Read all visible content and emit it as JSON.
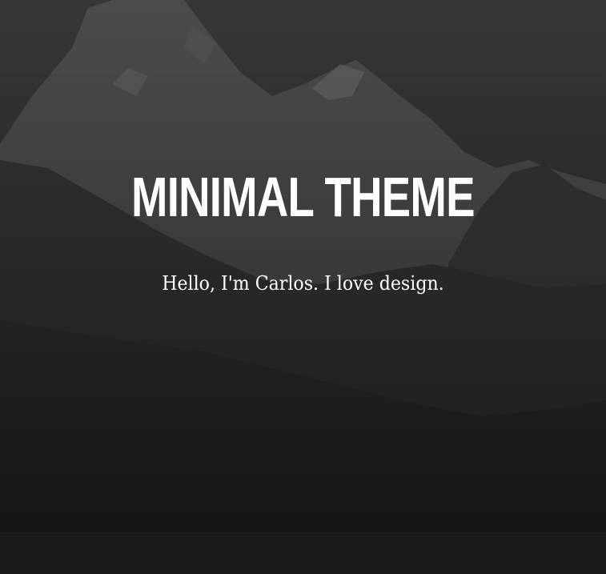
{
  "hero": {
    "title": "MINIMAL THEME",
    "tagline": "Hello, I'm Carlos. I love design."
  },
  "colors": {
    "title_text": "#ffffff",
    "tagline_text": "#ffffff",
    "footer_background": "#1b1b1b"
  }
}
